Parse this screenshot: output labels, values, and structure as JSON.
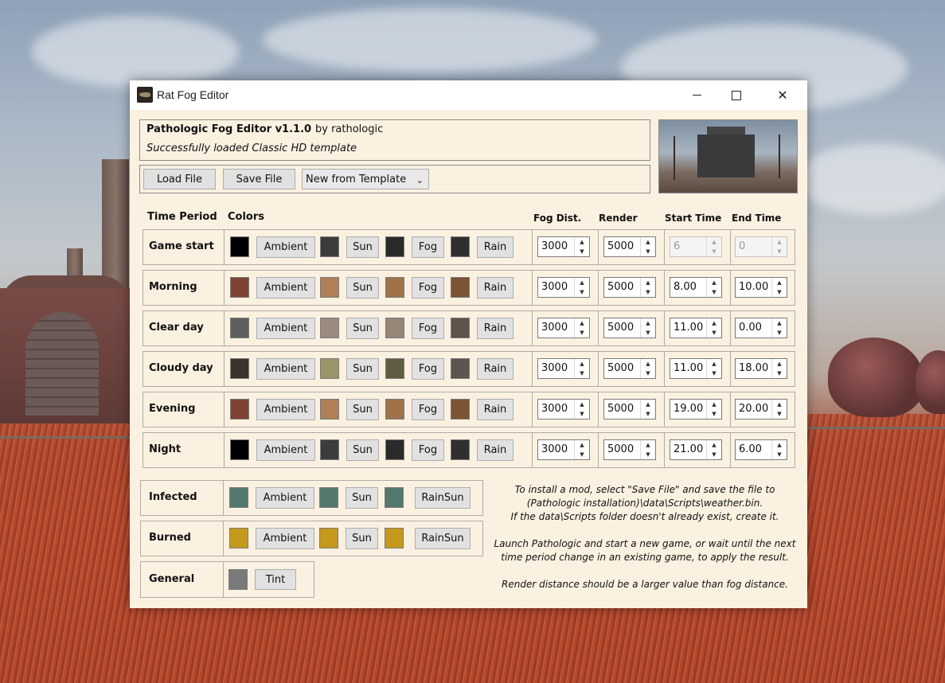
{
  "window": {
    "title": "Rat Fog Editor",
    "controls": {
      "minimize": "minimize",
      "maximize": "maximize",
      "close": "✕"
    }
  },
  "header": {
    "app_name": "Pathologic Fog Editor v1.1.0",
    "author": "by rathologic",
    "status": "Successfully loaded Classic HD template"
  },
  "toolbar": {
    "load_label": "Load File",
    "save_label": "Save File",
    "template_select": "New from Template"
  },
  "columns": {
    "time_period": "Time Period",
    "colors": "Colors",
    "fog_dist": "Fog Dist.",
    "render": "Render",
    "start_time": "Start Time",
    "end_time": "End Time"
  },
  "color_buttons": {
    "ambient": "Ambient",
    "sun": "Sun",
    "fog": "Fog",
    "rain": "Rain",
    "rainsun": "RainSun",
    "tint": "Tint"
  },
  "periods": [
    {
      "name": "Game start",
      "colors": [
        "#000000",
        "#3c3c3c",
        "#2a2a2a",
        "#2f2f2f"
      ],
      "fog": "3000",
      "render": "5000",
      "start": "6",
      "end": "0",
      "times_disabled": true
    },
    {
      "name": "Morning",
      "colors": [
        "#7e4331",
        "#b07f55",
        "#9f724a",
        "#7b5434"
      ],
      "fog": "3000",
      "render": "5000",
      "start": "8.00",
      "end": "10.00",
      "times_disabled": false
    },
    {
      "name": "Clear day",
      "colors": [
        "#5f5f5f",
        "#9a8b80",
        "#958676",
        "#5e544c"
      ],
      "fog": "3000",
      "render": "5000",
      "start": "11.00",
      "end": "0.00",
      "times_disabled": false
    },
    {
      "name": "Cloudy day",
      "colors": [
        "#3a342c",
        "#9b9568",
        "#615d44",
        "#5c5550"
      ],
      "fog": "3000",
      "render": "5000",
      "start": "11.00",
      "end": "18.00",
      "times_disabled": false
    },
    {
      "name": "Evening",
      "colors": [
        "#7e4331",
        "#b07f55",
        "#9f724a",
        "#7b5434"
      ],
      "fog": "3000",
      "render": "5000",
      "start": "19.00",
      "end": "20.00",
      "times_disabled": false
    },
    {
      "name": "Night",
      "colors": [
        "#000000",
        "#3c3c3c",
        "#2a2a2a",
        "#2f2f2f"
      ],
      "fog": "3000",
      "render": "5000",
      "start": "21.00",
      "end": "6.00",
      "times_disabled": false
    }
  ],
  "special": [
    {
      "name": "Infected",
      "colors": [
        "#54786e",
        "#54786e",
        "#54786e"
      ]
    },
    {
      "name": "Burned",
      "colors": [
        "#c59a1c",
        "#c59a1c",
        "#c59a1c"
      ]
    }
  ],
  "general": {
    "name": "General",
    "tint_color": "#7a7a7a"
  },
  "info": {
    "line1": "To install a mod, select \"Save File\" and save the file to",
    "line2": "(Pathologic installation)\\data\\Scripts\\weather.bin.",
    "line3": "If the data\\Scripts folder doesn't already exist, create it.",
    "line4": "Launch Pathologic and start a new game, or wait until the next",
    "line5": "time period change in an existing game, to apply the result.",
    "line6": "Render distance should be a larger value than fog distance."
  }
}
